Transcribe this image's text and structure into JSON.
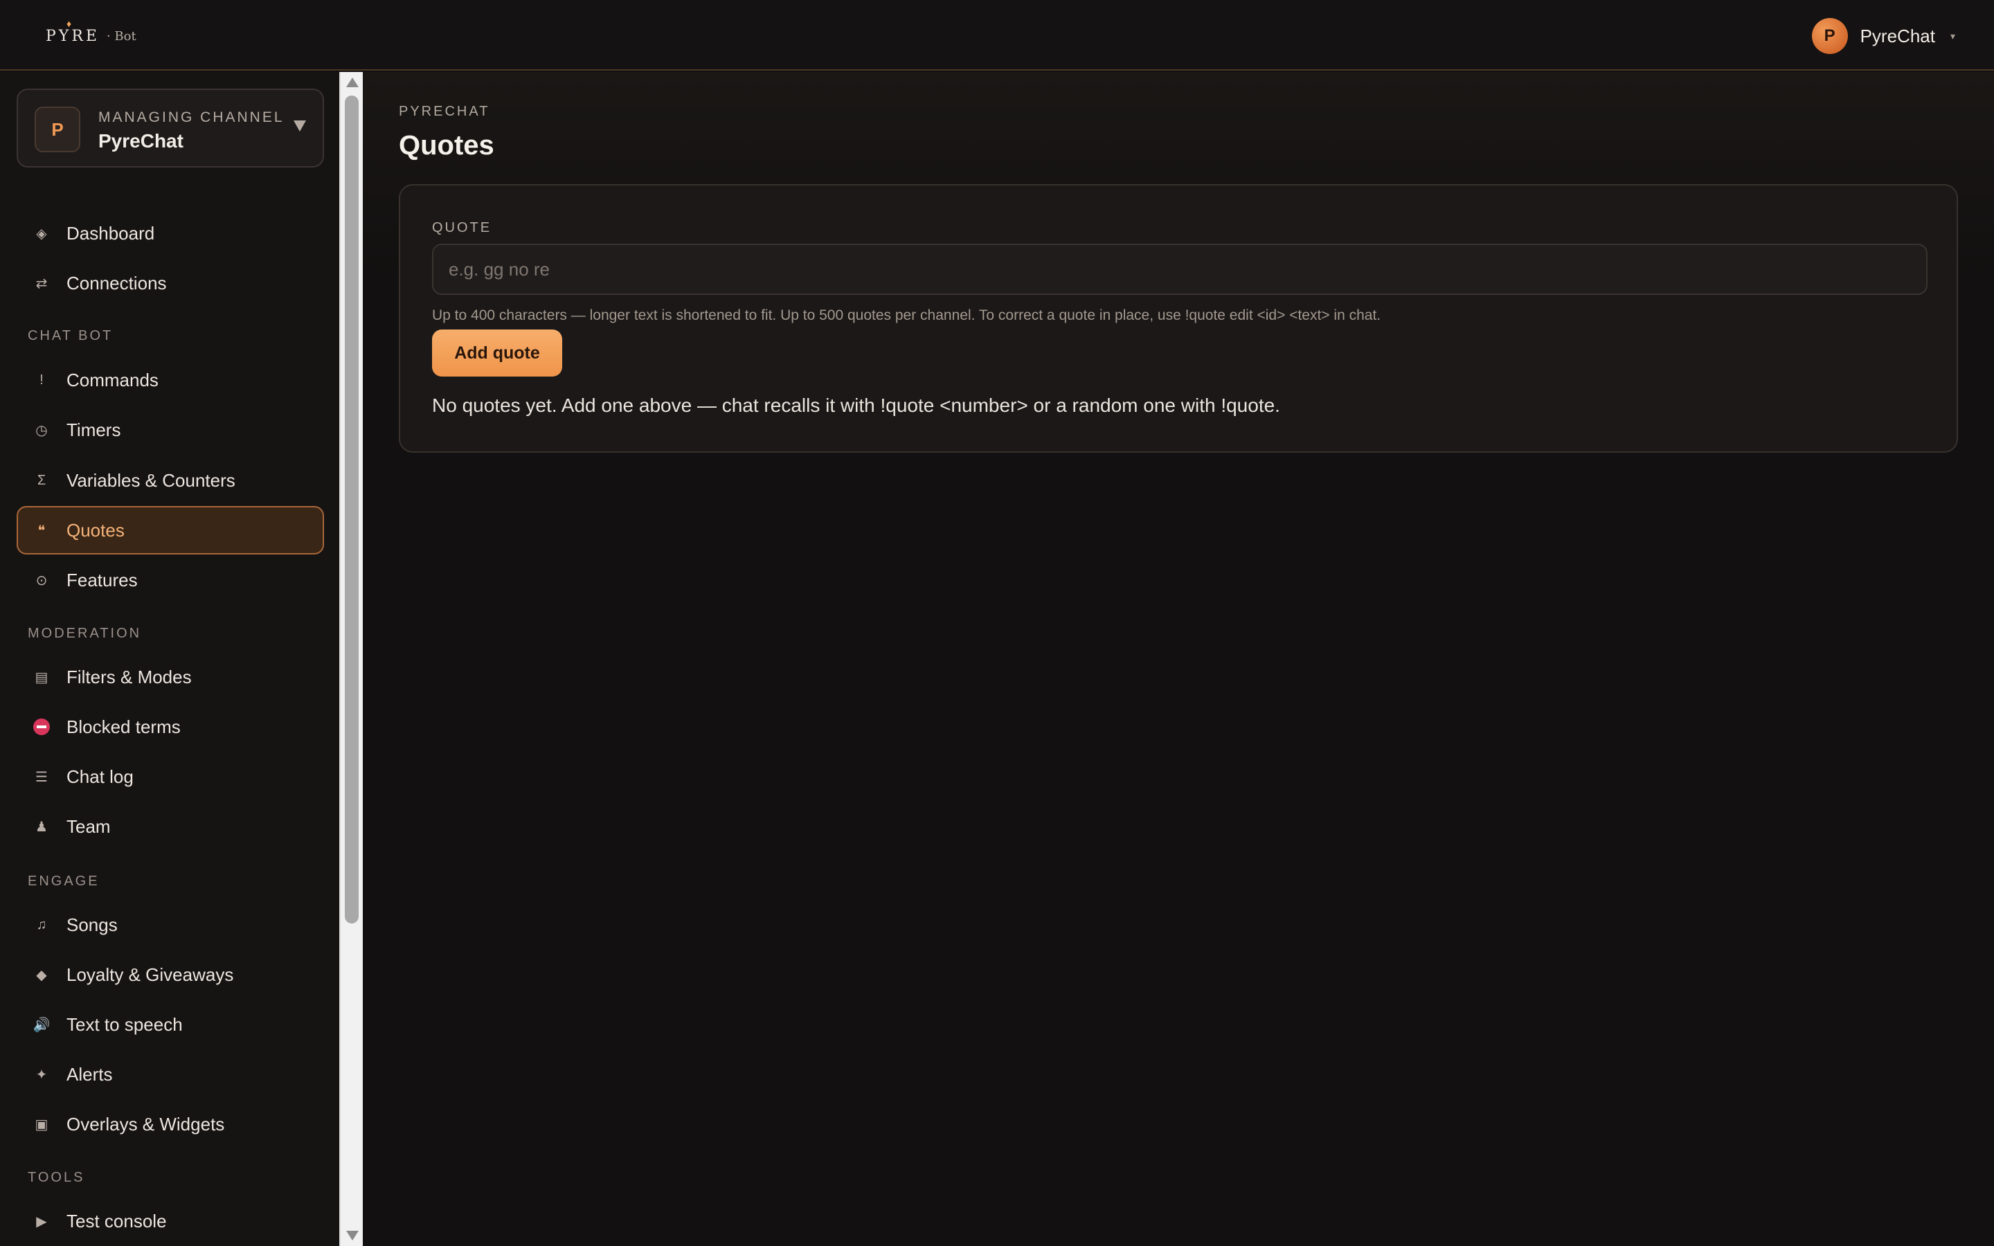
{
  "header": {
    "logo_word": "PYRE",
    "logo_sub": "· Bot",
    "user_initial": "P",
    "user_name": "PyreChat",
    "user_caret": "▾"
  },
  "channel": {
    "label": "Managing channel",
    "name": "PyreChat",
    "initial": "P"
  },
  "sections": {
    "chat_bot": "Chat bot",
    "moderation": "Moderation",
    "engage": "Engage",
    "tools": "Tools"
  },
  "nav": {
    "dashboard": "Dashboard",
    "connections": "Connections",
    "commands": "Commands",
    "timers": "Timers",
    "variables": "Variables & Counters",
    "quotes": "Quotes",
    "features": "Features",
    "filters": "Filters & Modes",
    "blocked": "Blocked terms",
    "chatlog": "Chat log",
    "team": "Team",
    "songs": "Songs",
    "loyalty": "Loyalty & Giveaways",
    "tts": "Text to speech",
    "alerts": "Alerts",
    "overlays": "Overlays & Widgets",
    "test_console": "Test console"
  },
  "icons": {
    "dashboard": "◈",
    "connections": "⇄",
    "commands": "!",
    "timers": "◷",
    "variables": "Σ",
    "quotes": "❝",
    "features": "⊙",
    "filters": "▤",
    "chatlog": "☰",
    "team": "♟",
    "songs": "♫",
    "loyalty": "◆",
    "tts": "🔊",
    "alerts": "✦",
    "overlays": "▣",
    "test_console": "▶"
  },
  "main": {
    "breadcrumb": "PyreChat",
    "title": "Quotes",
    "field_label": "Quote",
    "input_placeholder": "e.g. gg no re",
    "input_value": "",
    "help_text": "Up to 400 characters — longer text is shortened to fit. Up to 500 quotes per channel. To correct a quote in place, use !quote edit <id> <text> in chat.",
    "add_button": "Add quote",
    "empty_text": "No quotes yet. Add one above — chat recalls it with !quote <number> or a random one with !quote."
  },
  "colors": {
    "accent": "#f09a55",
    "background": "#121010",
    "danger": "#d9365c"
  }
}
